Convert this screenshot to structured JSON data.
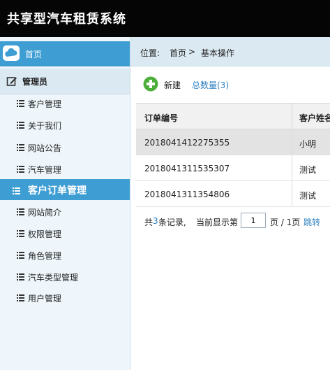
{
  "header": {
    "title": "共享型汽车租赁系统"
  },
  "sidebar": {
    "home_label": "首页",
    "section_label": "管理员",
    "items": [
      {
        "label": "客户管理",
        "active": false
      },
      {
        "label": "关于我们",
        "active": false
      },
      {
        "label": "网站公告",
        "active": false
      },
      {
        "label": "汽车管理",
        "active": false
      },
      {
        "label": "客户订单管理",
        "active": true
      },
      {
        "label": "网站简介",
        "active": false
      },
      {
        "label": "权限管理",
        "active": false
      },
      {
        "label": "角色管理",
        "active": false
      },
      {
        "label": "汽车类型管理",
        "active": false
      },
      {
        "label": "用户管理",
        "active": false
      }
    ]
  },
  "breadcrumb": {
    "label": "位置:",
    "home": "首页",
    "separator": ">",
    "current": "基本操作"
  },
  "toolbar": {
    "new_label": "新建",
    "total_label": "总数量(3)"
  },
  "table": {
    "headers": [
      "订单编号",
      "客户姓名"
    ],
    "rows": [
      {
        "order_no": "20180414122753​55",
        "customer": "小明",
        "highlight": true
      },
      {
        "order_no": "2018041311535307",
        "customer": "测试",
        "highlight": false
      },
      {
        "order_no": "2018041311354806",
        "customer": "测试",
        "highlight": false
      }
    ]
  },
  "pager": {
    "prefix": "共",
    "count": "3",
    "records_suffix": "条记录,",
    "current_label": "当前显示第",
    "page_value": "1",
    "page_total": "页 / 1页",
    "jump_label": "跳转"
  },
  "colors": {
    "accent": "#3e9ed3",
    "link": "#2b7fc0",
    "topbar": "#050505",
    "plus_icon": "#4caf3c"
  }
}
